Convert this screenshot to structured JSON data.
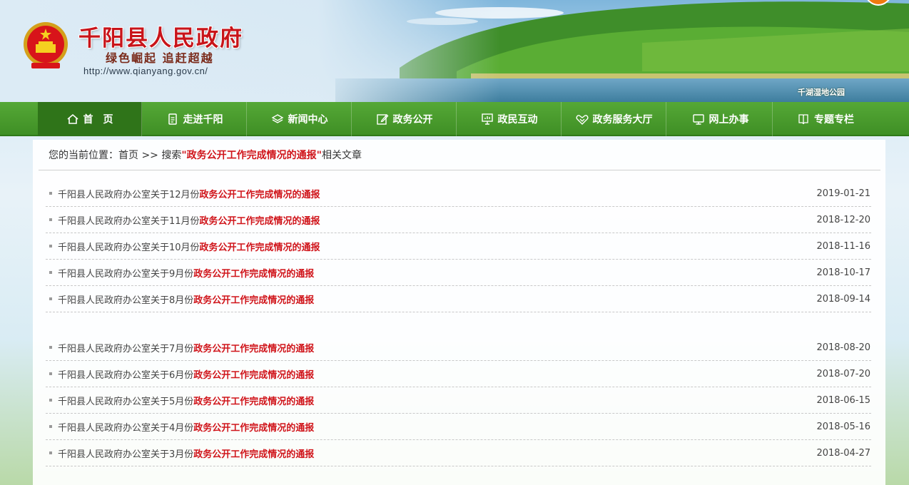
{
  "header": {
    "title": "千阳县人民政府",
    "slogan": "绿色崛起 追赶超越",
    "url": "http://www.qianyang.gov.cn/",
    "photo_caption": "千湖湿地公园"
  },
  "nav": {
    "items": [
      {
        "label": "首　页",
        "icon": "home-icon"
      },
      {
        "label": "走进千阳",
        "icon": "document-icon"
      },
      {
        "label": "新闻中心",
        "icon": "layers-icon"
      },
      {
        "label": "政务公开",
        "icon": "edit-icon"
      },
      {
        "label": "政民互动",
        "icon": "presentation-icon"
      },
      {
        "label": "政务服务大厅",
        "icon": "handshake-icon"
      },
      {
        "label": "网上办事",
        "icon": "monitor-icon"
      },
      {
        "label": "专题专栏",
        "icon": "book-icon"
      }
    ]
  },
  "breadcrumb": {
    "prefix": "您的当前位置：首页 >> 搜索 ",
    "keyword": "\"政务公开工作完成情况的通报\"",
    "suffix": "相关文章"
  },
  "articles": {
    "group1": [
      {
        "prefix": "千阳县人民政府办公室关于12月份",
        "highlight": "政务公开工作完成情况的通报",
        "date": "2019-01-21"
      },
      {
        "prefix": "千阳县人民政府办公室关于11月份",
        "highlight": "政务公开工作完成情况的通报",
        "date": "2018-12-20"
      },
      {
        "prefix": "千阳县人民政府办公室关于10月份",
        "highlight": "政务公开工作完成情况的通报",
        "date": "2018-11-16"
      },
      {
        "prefix": "千阳县人民政府办公室关于9月份",
        "highlight": "政务公开工作完成情况的通报",
        "date": "2018-10-17"
      },
      {
        "prefix": "千阳县人民政府办公室关于8月份",
        "highlight": "政务公开工作完成情况的通报",
        "date": "2018-09-14"
      }
    ],
    "group2": [
      {
        "prefix": "千阳县人民政府办公室关于7月份",
        "highlight": "政务公开工作完成情况的通报",
        "date": "2018-08-20"
      },
      {
        "prefix": "千阳县人民政府办公室关于6月份",
        "highlight": "政务公开工作完成情况的通报",
        "date": "2018-07-20"
      },
      {
        "prefix": "千阳县人民政府办公室关于5月份",
        "highlight": "政务公开工作完成情况的通报",
        "date": "2018-06-15"
      },
      {
        "prefix": "千阳县人民政府办公室关于4月份",
        "highlight": "政务公开工作完成情况的通报",
        "date": "2018-05-16"
      },
      {
        "prefix": "千阳县人民政府办公室关于3月份",
        "highlight": "政务公开工作完成情况的通报",
        "date": "2018-04-27"
      }
    ]
  },
  "colors": {
    "brand_red": "#c8141a",
    "nav_green": "#4a9c2e",
    "highlight_red": "#d0141a"
  }
}
